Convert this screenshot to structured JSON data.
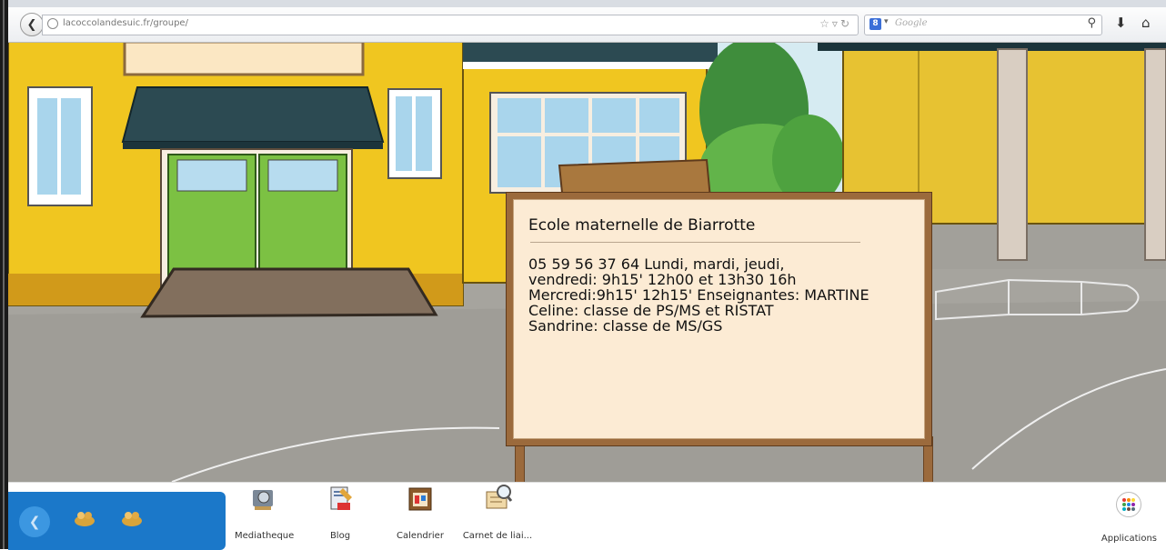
{
  "browser": {
    "url": "lacoccolandesuic.fr/groupe/",
    "search_placeholder": "Google",
    "search_engine_badge": "8"
  },
  "notice": {
    "title": "Ecole maternelle de Biarrotte",
    "lines": [
      "05 59 56 37 64 Lundi, mardi, jeudi,",
      "vendredi: 9h15' 12h00 et 13h30 16h",
      "Mercredi:9h15' 12h15' Enseignantes: MARTINE",
      "Celine: classe de PS/MS et RISTAT",
      "Sandrine: classe de MS/GS"
    ]
  },
  "taskbar": {
    "items": [
      {
        "label": "Mediatheque",
        "icon": "media-library-icon"
      },
      {
        "label": "Blog",
        "icon": "blog-icon"
      },
      {
        "label": "Calendrier",
        "icon": "calendar-icon"
      },
      {
        "label": "Carnet de liai...",
        "icon": "notebook-icon"
      }
    ],
    "apps_label": "Applications"
  },
  "colors": {
    "blue_panel": "#1b78c9",
    "wall_yellow": "#f2c823",
    "door_green": "#7cc143",
    "awning": "#2c4a52",
    "board_wood": "#9b6a3c",
    "board_paper": "#fcebd4"
  }
}
